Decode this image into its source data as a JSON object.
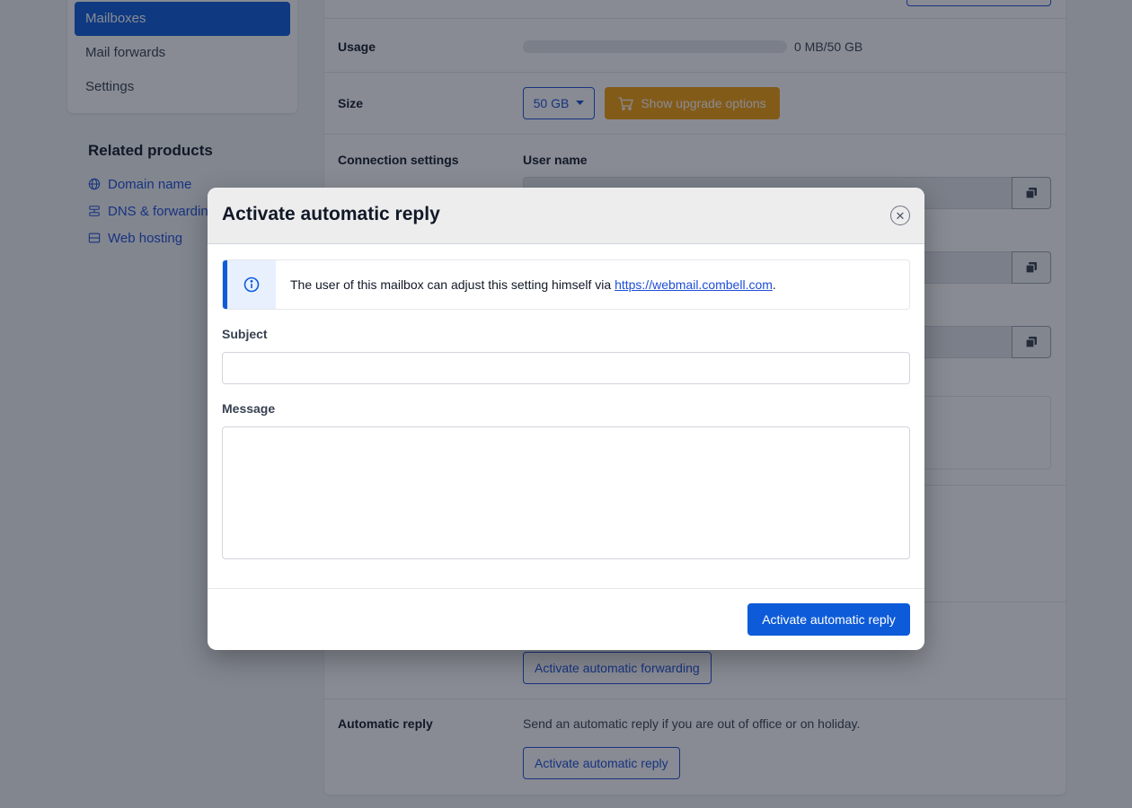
{
  "sidebar": {
    "items": [
      {
        "label": "Mailboxes",
        "active": true
      },
      {
        "label": "Mail forwards",
        "active": false
      },
      {
        "label": "Settings",
        "active": false
      }
    ]
  },
  "related": {
    "title": "Related products",
    "links": [
      {
        "label": "Domain name",
        "icon": "globe-icon"
      },
      {
        "label": "DNS & forwarding",
        "icon": "dns-icon"
      },
      {
        "label": "Web hosting",
        "icon": "server-icon"
      }
    ]
  },
  "main": {
    "usage": {
      "label": "Usage",
      "value": "0 MB/50 GB",
      "progress": 0
    },
    "size": {
      "label": "Size",
      "selected": "50 GB",
      "upgrade_label": "Show upgrade options"
    },
    "connection": {
      "label": "Connection settings",
      "username_label": "User name"
    },
    "forwarding": {
      "button_label": "Activate automatic forwarding"
    },
    "auto_reply": {
      "label": "Automatic reply",
      "description": "Send an automatic reply if you are out of office or on holiday.",
      "button_label": "Activate automatic reply"
    }
  },
  "modal": {
    "title": "Activate automatic reply",
    "info_text": "The user of this mailbox can adjust this setting himself via ",
    "info_link": "https://webmail.combell.com",
    "info_suffix": ".",
    "subject_label": "Subject",
    "subject_value": "",
    "message_label": "Message",
    "message_value": "",
    "submit_label": "Activate automatic reply"
  },
  "colors": {
    "primary": "#0d5bd8",
    "warning": "#f59e0b",
    "overlay": "rgba(17,24,39,0.5)"
  }
}
